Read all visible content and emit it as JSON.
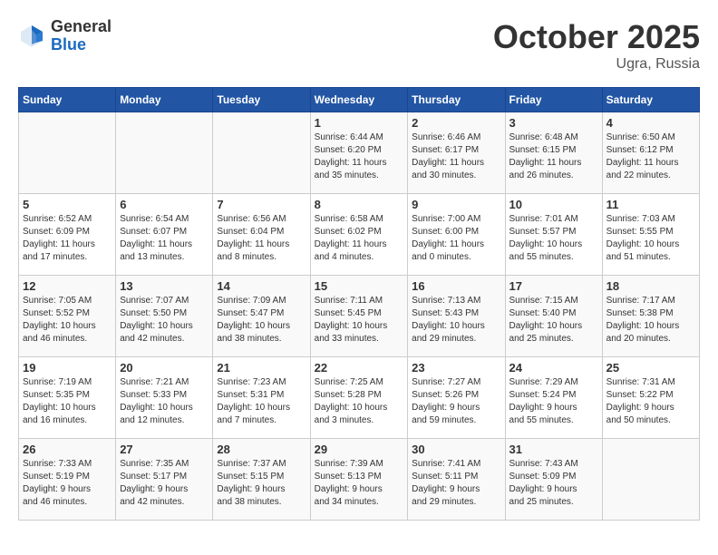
{
  "header": {
    "logo_general": "General",
    "logo_blue": "Blue",
    "month": "October 2025",
    "location": "Ugra, Russia"
  },
  "days_of_week": [
    "Sunday",
    "Monday",
    "Tuesday",
    "Wednesday",
    "Thursday",
    "Friday",
    "Saturday"
  ],
  "weeks": [
    [
      {
        "day": "",
        "info": ""
      },
      {
        "day": "",
        "info": ""
      },
      {
        "day": "",
        "info": ""
      },
      {
        "day": "1",
        "info": "Sunrise: 6:44 AM\nSunset: 6:20 PM\nDaylight: 11 hours\nand 35 minutes."
      },
      {
        "day": "2",
        "info": "Sunrise: 6:46 AM\nSunset: 6:17 PM\nDaylight: 11 hours\nand 30 minutes."
      },
      {
        "day": "3",
        "info": "Sunrise: 6:48 AM\nSunset: 6:15 PM\nDaylight: 11 hours\nand 26 minutes."
      },
      {
        "day": "4",
        "info": "Sunrise: 6:50 AM\nSunset: 6:12 PM\nDaylight: 11 hours\nand 22 minutes."
      }
    ],
    [
      {
        "day": "5",
        "info": "Sunrise: 6:52 AM\nSunset: 6:09 PM\nDaylight: 11 hours\nand 17 minutes."
      },
      {
        "day": "6",
        "info": "Sunrise: 6:54 AM\nSunset: 6:07 PM\nDaylight: 11 hours\nand 13 minutes."
      },
      {
        "day": "7",
        "info": "Sunrise: 6:56 AM\nSunset: 6:04 PM\nDaylight: 11 hours\nand 8 minutes."
      },
      {
        "day": "8",
        "info": "Sunrise: 6:58 AM\nSunset: 6:02 PM\nDaylight: 11 hours\nand 4 minutes."
      },
      {
        "day": "9",
        "info": "Sunrise: 7:00 AM\nSunset: 6:00 PM\nDaylight: 11 hours\nand 0 minutes."
      },
      {
        "day": "10",
        "info": "Sunrise: 7:01 AM\nSunset: 5:57 PM\nDaylight: 10 hours\nand 55 minutes."
      },
      {
        "day": "11",
        "info": "Sunrise: 7:03 AM\nSunset: 5:55 PM\nDaylight: 10 hours\nand 51 minutes."
      }
    ],
    [
      {
        "day": "12",
        "info": "Sunrise: 7:05 AM\nSunset: 5:52 PM\nDaylight: 10 hours\nand 46 minutes."
      },
      {
        "day": "13",
        "info": "Sunrise: 7:07 AM\nSunset: 5:50 PM\nDaylight: 10 hours\nand 42 minutes."
      },
      {
        "day": "14",
        "info": "Sunrise: 7:09 AM\nSunset: 5:47 PM\nDaylight: 10 hours\nand 38 minutes."
      },
      {
        "day": "15",
        "info": "Sunrise: 7:11 AM\nSunset: 5:45 PM\nDaylight: 10 hours\nand 33 minutes."
      },
      {
        "day": "16",
        "info": "Sunrise: 7:13 AM\nSunset: 5:43 PM\nDaylight: 10 hours\nand 29 minutes."
      },
      {
        "day": "17",
        "info": "Sunrise: 7:15 AM\nSunset: 5:40 PM\nDaylight: 10 hours\nand 25 minutes."
      },
      {
        "day": "18",
        "info": "Sunrise: 7:17 AM\nSunset: 5:38 PM\nDaylight: 10 hours\nand 20 minutes."
      }
    ],
    [
      {
        "day": "19",
        "info": "Sunrise: 7:19 AM\nSunset: 5:35 PM\nDaylight: 10 hours\nand 16 minutes."
      },
      {
        "day": "20",
        "info": "Sunrise: 7:21 AM\nSunset: 5:33 PM\nDaylight: 10 hours\nand 12 minutes."
      },
      {
        "day": "21",
        "info": "Sunrise: 7:23 AM\nSunset: 5:31 PM\nDaylight: 10 hours\nand 7 minutes."
      },
      {
        "day": "22",
        "info": "Sunrise: 7:25 AM\nSunset: 5:28 PM\nDaylight: 10 hours\nand 3 minutes."
      },
      {
        "day": "23",
        "info": "Sunrise: 7:27 AM\nSunset: 5:26 PM\nDaylight: 9 hours\nand 59 minutes."
      },
      {
        "day": "24",
        "info": "Sunrise: 7:29 AM\nSunset: 5:24 PM\nDaylight: 9 hours\nand 55 minutes."
      },
      {
        "day": "25",
        "info": "Sunrise: 7:31 AM\nSunset: 5:22 PM\nDaylight: 9 hours\nand 50 minutes."
      }
    ],
    [
      {
        "day": "26",
        "info": "Sunrise: 7:33 AM\nSunset: 5:19 PM\nDaylight: 9 hours\nand 46 minutes."
      },
      {
        "day": "27",
        "info": "Sunrise: 7:35 AM\nSunset: 5:17 PM\nDaylight: 9 hours\nand 42 minutes."
      },
      {
        "day": "28",
        "info": "Sunrise: 7:37 AM\nSunset: 5:15 PM\nDaylight: 9 hours\nand 38 minutes."
      },
      {
        "day": "29",
        "info": "Sunrise: 7:39 AM\nSunset: 5:13 PM\nDaylight: 9 hours\nand 34 minutes."
      },
      {
        "day": "30",
        "info": "Sunrise: 7:41 AM\nSunset: 5:11 PM\nDaylight: 9 hours\nand 29 minutes."
      },
      {
        "day": "31",
        "info": "Sunrise: 7:43 AM\nSunset: 5:09 PM\nDaylight: 9 hours\nand 25 minutes."
      },
      {
        "day": "",
        "info": ""
      }
    ]
  ]
}
